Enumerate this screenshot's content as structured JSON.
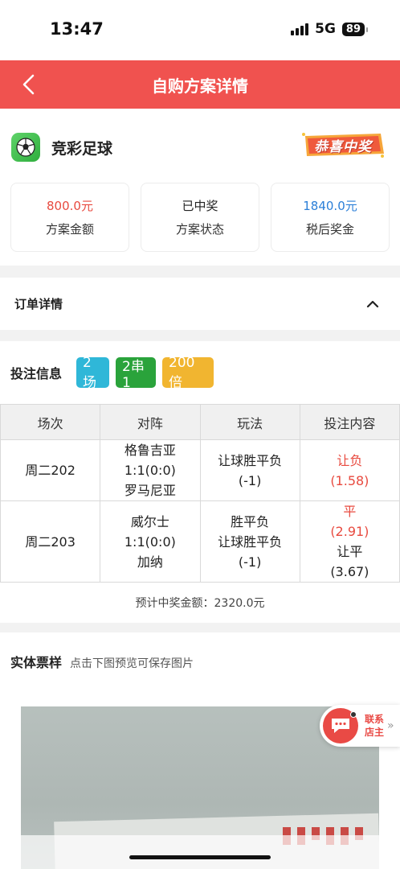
{
  "status_bar": {
    "time": "13:47",
    "network": "5G",
    "battery": "89"
  },
  "navbar": {
    "title": "自购方案详情",
    "back_icon": "chevron-left-icon"
  },
  "game": {
    "name": "竞彩足球",
    "icon": "soccer-ball-icon",
    "win_badge": "恭喜中奖"
  },
  "stats": [
    {
      "value": "800.0元",
      "label": "方案金额",
      "color": "#e84a3f"
    },
    {
      "value": "已中奖",
      "label": "方案状态",
      "color": "#222222"
    },
    {
      "value": "1840.0元",
      "label": "税后奖金",
      "color": "#2b7fd8"
    }
  ],
  "order": {
    "title": "订单详情",
    "toggle_icon": "chevron-up-icon"
  },
  "bet": {
    "title": "投注信息",
    "tags": [
      {
        "label": "2场",
        "color": "#2fb7d8"
      },
      {
        "label": "2串1",
        "color": "#2aa33b"
      },
      {
        "label": "200倍",
        "color": "#f1b530"
      }
    ],
    "headers": [
      "场次",
      "对阵",
      "玩法",
      "投注内容"
    ],
    "rows": [
      {
        "match_no": "周二202",
        "home": "格鲁吉亚",
        "score": "1:1(0:0)",
        "away": "罗马尼亚",
        "play_1": "让球胜平负",
        "play_2": "(-1)",
        "picks": [
          {
            "name": "让负",
            "odds": "(1.58)",
            "hit": true
          }
        ]
      },
      {
        "match_no": "周二203",
        "home": "威尔士",
        "score": "1:1(0:0)",
        "away": "加纳",
        "play_1": "胜平负",
        "play_2": "让球胜平负",
        "play_3": "(-1)",
        "picks": [
          {
            "name": "平",
            "odds": "(2.91)",
            "hit": true
          },
          {
            "name": "让平",
            "odds": "(3.67)",
            "hit": false
          }
        ]
      }
    ],
    "expected": "预计中奖金额：2320.0元"
  },
  "ticket": {
    "title": "实体票样",
    "hint": "点击下图预览可保存图片"
  },
  "contact": {
    "line1": "联系",
    "line2": "店主",
    "icon": "chat-bubble-icon",
    "arrow": "»"
  }
}
